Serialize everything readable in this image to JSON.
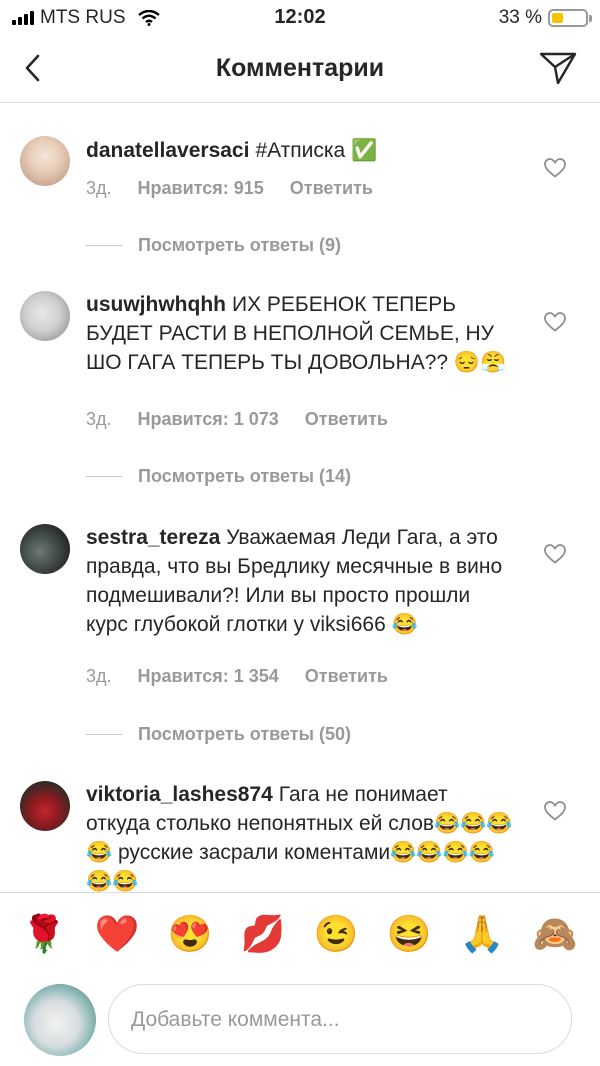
{
  "status": {
    "carrier": "MTS RUS",
    "time": "12:02",
    "battery": "33 %",
    "battery_level": 0.33,
    "battery_color": "#f5c400"
  },
  "header": {
    "title": "Комментарии",
    "back_icon": "chevron-left-icon",
    "send_icon": "paper-plane-icon"
  },
  "comments": [
    {
      "username": "danatellaversaci",
      "text": "#Атписка ✅",
      "time": "3д.",
      "likes": "Нравится: 915",
      "reply": "Ответить",
      "view_replies": "Посмотреть ответы (9)"
    },
    {
      "username": "usuwjhwhqhh",
      "text": "ИХ РЕБЕНОК ТЕПЕРЬ БУДЕТ РАСТИ В НЕПОЛНОЙ СЕМЬЕ, НУ ШО ГАГА ТЕПЕРЬ ТЫ ДОВОЛЬНА?? 😔😤",
      "time": "3д.",
      "likes": "Нравится: 1 073",
      "reply": "Ответить",
      "view_replies": "Посмотреть ответы (14)"
    },
    {
      "username": "sestra_tereza",
      "text": "Уважаемая Леди Гага, а это правда, что вы Бредлику месячные в вино подмешивали?! Или вы просто прошли курс глубокой глотки у viksi666 😂",
      "time": "3д.",
      "likes": "Нравится: 1 354",
      "reply": "Ответить",
      "view_replies": "Посмотреть ответы (50)"
    },
    {
      "username": "viktoria_lashes874",
      "text": "Гага не понимает откуда столько непонятных ей слов😂😂😂😂 русские засрали коментами😂😂😂😂😂😂"
    }
  ],
  "emoji_bar": [
    "🌹",
    "❤️",
    "😍",
    "💋",
    "😉",
    "😆",
    "🙏",
    "🙈"
  ],
  "composer": {
    "placeholder": "Добавьте коммента..."
  },
  "colors": {
    "text": "#262626",
    "muted": "#999999",
    "divider": "#dbdbdb"
  }
}
